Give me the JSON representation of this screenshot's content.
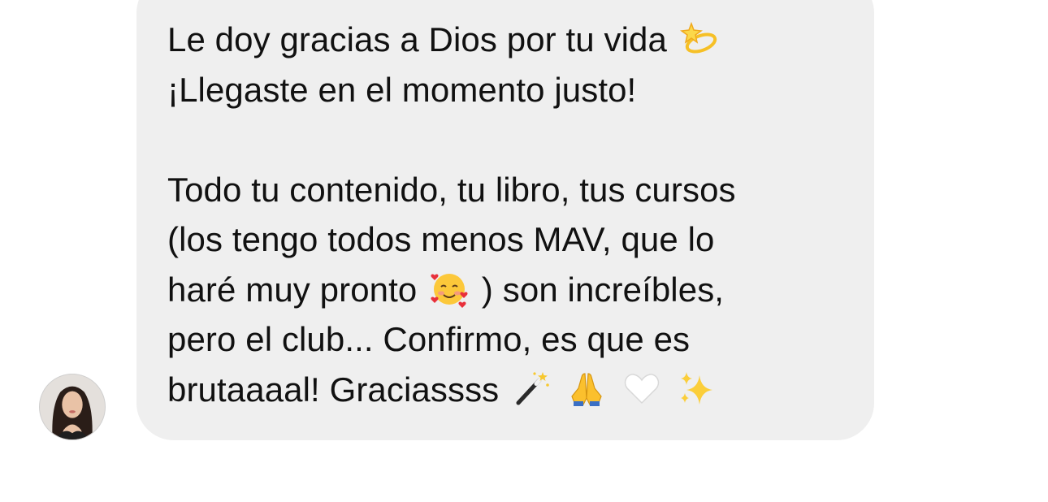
{
  "message": {
    "line1": "Le doy gracias a Dios por tu vida",
    "line2": "¡Llegaste en el momento justo!",
    "line3": "Todo tu contenido, tu libro, tus cursos",
    "line4": "(los tengo todos menos MAV, que lo",
    "line5a": "haré muy pronto",
    "line5b": ") son increíbles,",
    "line6": "pero el club... Confirmo, es que es",
    "line7": "brutaaaal! Graciassss"
  },
  "emojis": {
    "dizzy": "dizzy-star-icon",
    "smiling_hearts": "smiling-face-with-hearts-icon",
    "magic_wand": "magic-wand-icon",
    "praying_hands": "folded-hands-icon",
    "white_heart": "white-heart-icon",
    "sparkles": "sparkles-icon"
  },
  "colors": {
    "bubble": "#efefef",
    "text": "#111111",
    "background": "#ffffff"
  }
}
